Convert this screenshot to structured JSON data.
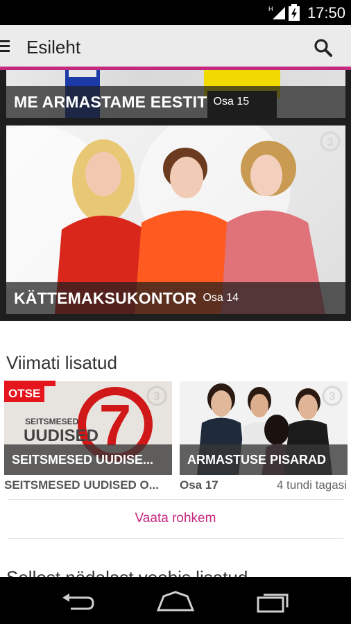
{
  "status_bar": {
    "time": "17:50",
    "network": "H"
  },
  "action_bar": {
    "title": "Esileht",
    "accent_color": "#c5287f"
  },
  "featured": [
    {
      "title": "ME ARMASTAME EESTIT",
      "episode": "Osa 15"
    },
    {
      "title": "KÄTTEMAKSUKONTOR",
      "episode": "Osa 14"
    }
  ],
  "recently_added": {
    "heading": "Viimati lisatud",
    "items": [
      {
        "badge": "OTSE",
        "logo_line1": "SEITSMESED",
        "logo_line2": "UUDISED",
        "logo_number": "7",
        "caption": "SEITSMESED UUDISE...",
        "meta": "SEITSMESED UUDISED O..."
      },
      {
        "caption": "ARMASTUSE PISARAD",
        "episode": "Osa 17",
        "time_ago": "4 tundi tagasi"
      }
    ],
    "more_label": "Vaata rohkem"
  },
  "next_section": {
    "heading": "Sellest nädalast veebis lisatud"
  },
  "icons": {
    "menu": "menu-icon",
    "search": "search-icon",
    "channel_logo": "channel-3-logo",
    "back": "back-icon",
    "home": "home-icon",
    "recents": "recent-apps-icon"
  }
}
